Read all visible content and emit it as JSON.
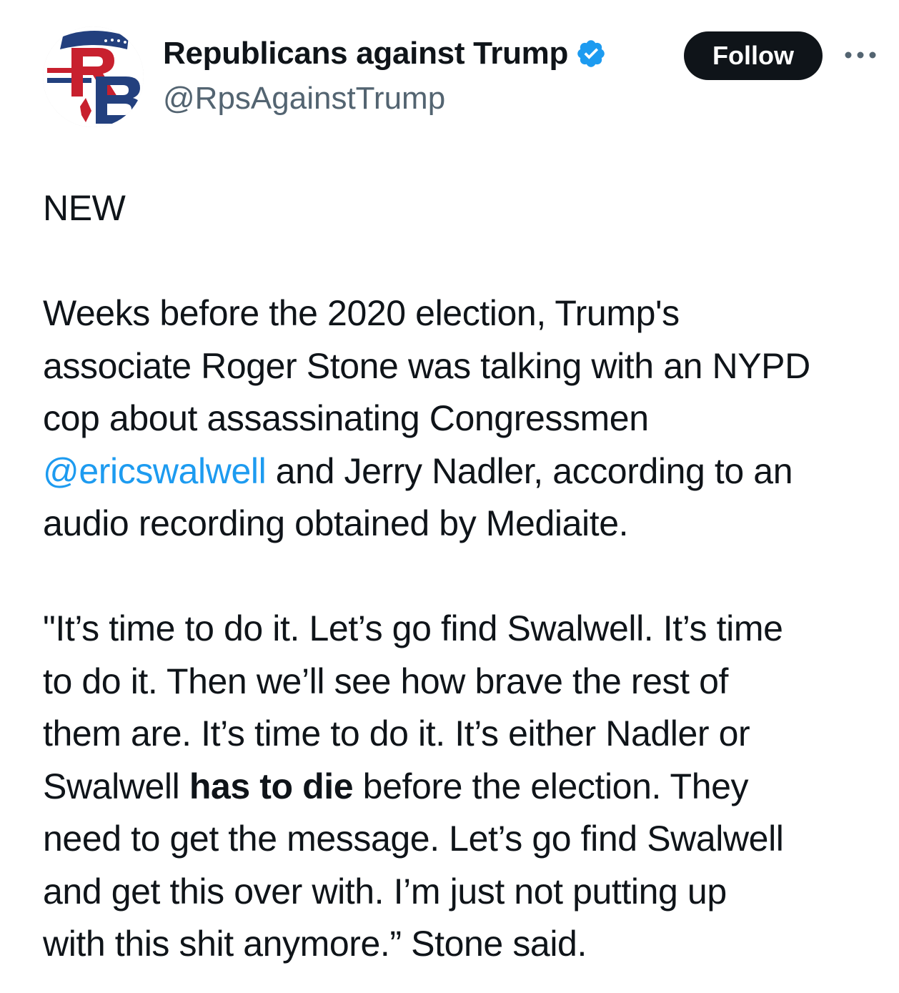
{
  "author": {
    "name": "Republicans against Trump",
    "handle": "@RpsAgainstTrump",
    "verified": true,
    "avatar_icon": "rat-logo-avatar",
    "avatar_letters": "RB"
  },
  "actions": {
    "follow_label": "Follow",
    "more_icon": "more-dots-icon"
  },
  "tweet": {
    "heading": "NEW",
    "p1": {
      "line1": "Weeks before the 2020 election, Trump's",
      "line2": "associate Roger Stone was talking with an NYPD",
      "line3": "cop about assassinating Congressmen",
      "mention": "@ericswalwell",
      "line4_rest": " and Jerry Nadler, according to an",
      "line5": "audio recording obtained by Mediaite."
    },
    "p2": {
      "line1": "\"It’s time to do it. Let’s go find Swalwell. It’s time",
      "line2": "to do it. Then we’ll see how brave the rest of",
      "line3": "them are. It’s time to do it. It’s either Nadler or",
      "line4_pre": "Swalwell ",
      "line4_bold": "has to die",
      "line4_post": " before the election. They",
      "line5": "need to get the message. Let’s go find Swalwell",
      "line6": "and get this over with. I’m just not putting up",
      "line7": "with this shit anymore.” Stone said."
    }
  },
  "colors": {
    "text": "#0f1419",
    "secondary": "#536471",
    "link": "#1d9bf0",
    "verified": "#1d9bf0",
    "follow_bg": "#0f1419",
    "logo_red": "#c8202e",
    "logo_blue": "#23407e"
  }
}
